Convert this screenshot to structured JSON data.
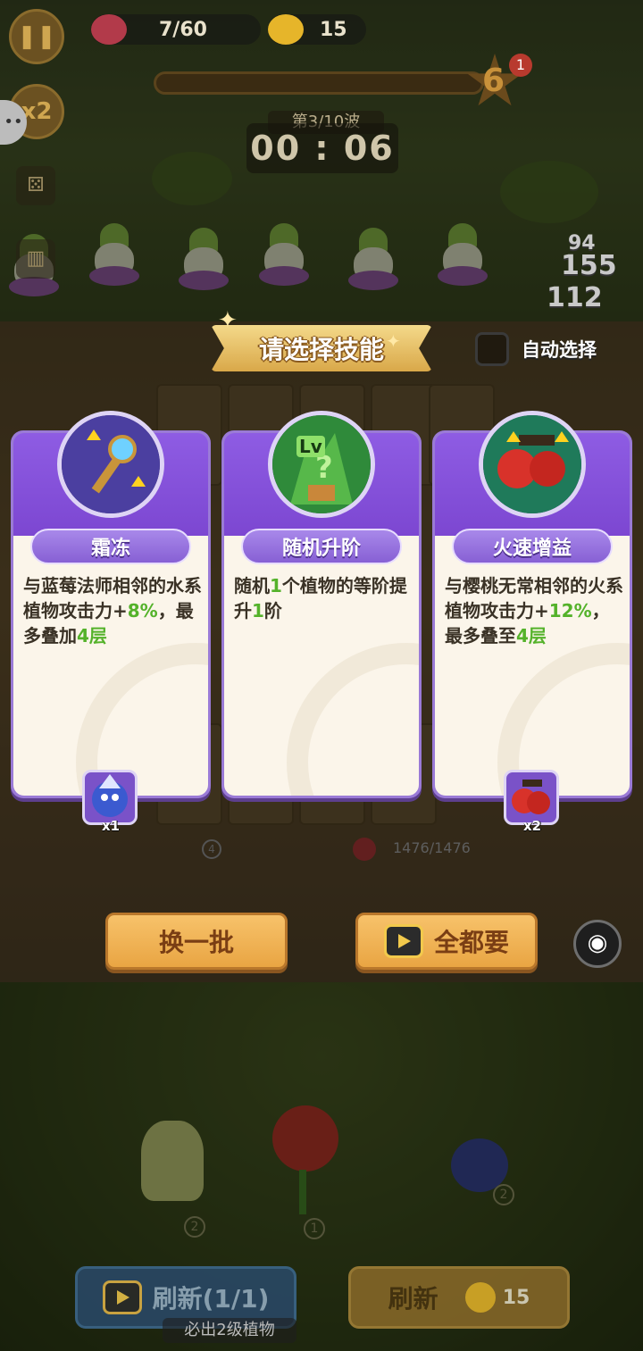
{
  "hud": {
    "pause_icon": "pause-icon",
    "speed_label": "x2",
    "enemy_count": "7/60",
    "sun_count": "15",
    "wave_level": "6",
    "wave_notice": "1",
    "wave_label": "第3/10波",
    "timer": "00 : 06",
    "damage_numbers": [
      "94",
      "155",
      "112"
    ]
  },
  "board": {
    "hp_text": "1476/1476",
    "tile_level": "4"
  },
  "skill_select": {
    "title": "请选择技能",
    "auto_select_label": "自动选择",
    "auto_select_checked": false,
    "cards": [
      {
        "name": "霜冻",
        "icon": "frost-staff-icon",
        "desc_parts": [
          "与蓝莓法师相邻的水系植物攻击力+",
          "8%",
          "，最多叠加",
          "4层"
        ],
        "badge_icon": "blueberry-mage-icon",
        "badge_count": "x1"
      },
      {
        "name": "随机升阶",
        "icon": "random-upgrade-icon",
        "icon_text": "Lv",
        "desc_parts": [
          "随机",
          "1",
          "个植物的等阶提升",
          "1",
          "阶"
        ],
        "badge_icon": "",
        "badge_count": ""
      },
      {
        "name": "火速增益",
        "icon": "cherry-fire-icon",
        "desc_parts": [
          "与樱桃无常相邻的火系植物攻击力+",
          "12%",
          "，最多叠至",
          "4层"
        ],
        "badge_icon": "cherry-icon",
        "badge_count": "x2"
      }
    ],
    "refresh_batch_label": "换一批",
    "take_all_label": "全都要",
    "eye_icon": "eye-icon"
  },
  "shop": {
    "plant_levels": [
      "2",
      "1",
      "2"
    ],
    "ad_refresh_label": "刷新(1/1)",
    "ad_refresh_note": "必出2级植物",
    "refresh_label": "刷新",
    "refresh_cost": "15"
  },
  "colors": {
    "card_purple": "#8e5ce3",
    "highlight_green": "#54b22a",
    "button_orange": "#f7c26a"
  }
}
